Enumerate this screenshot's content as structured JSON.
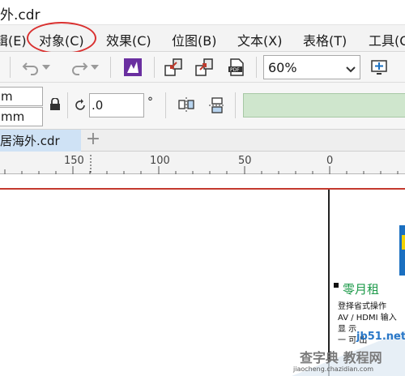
{
  "window": {
    "title": "外.cdr"
  },
  "menubar": {
    "items": [
      {
        "label": "辑(E)"
      },
      {
        "label": "对象(C)"
      },
      {
        "label": "效果(C)"
      },
      {
        "label": "位图(B)"
      },
      {
        "label": "文本(X)"
      },
      {
        "label": "表格(T)"
      },
      {
        "label": "工具(O"
      }
    ]
  },
  "toolbar": {
    "zoom_value": "60%",
    "icons": {
      "undo": "undo-icon",
      "redo": "redo-icon",
      "launch": "launch-icon",
      "import": "import-icon",
      "export": "export-icon",
      "pdf": "pdf-icon",
      "fullscreen": "fullscreen-icon"
    }
  },
  "property_bar": {
    "width_field": "m",
    "height_field": "mm",
    "angle_value": ".0",
    "degree_symbol": "°"
  },
  "doc_tab": {
    "label": "居海外.cdr",
    "add": "+"
  },
  "ruler": {
    "ticks": [
      "150",
      "100",
      "50",
      "0"
    ]
  },
  "canvas": {
    "page_title": "零月租",
    "page_lines": [
      "登择省式操作",
      "AV / HDMI 输入",
      "显 示",
      "一 可 出"
    ]
  },
  "watermark": {
    "url": "jb51.net",
    "main": "查字典 教程网",
    "sub": "jiaocheng.chazidian.com"
  },
  "colors": {
    "highlight_circle": "#d9302f",
    "doc_tab": "#cfe2f5",
    "green_box": "#cfe6cd",
    "accent_purple": "#6a2fa0"
  }
}
